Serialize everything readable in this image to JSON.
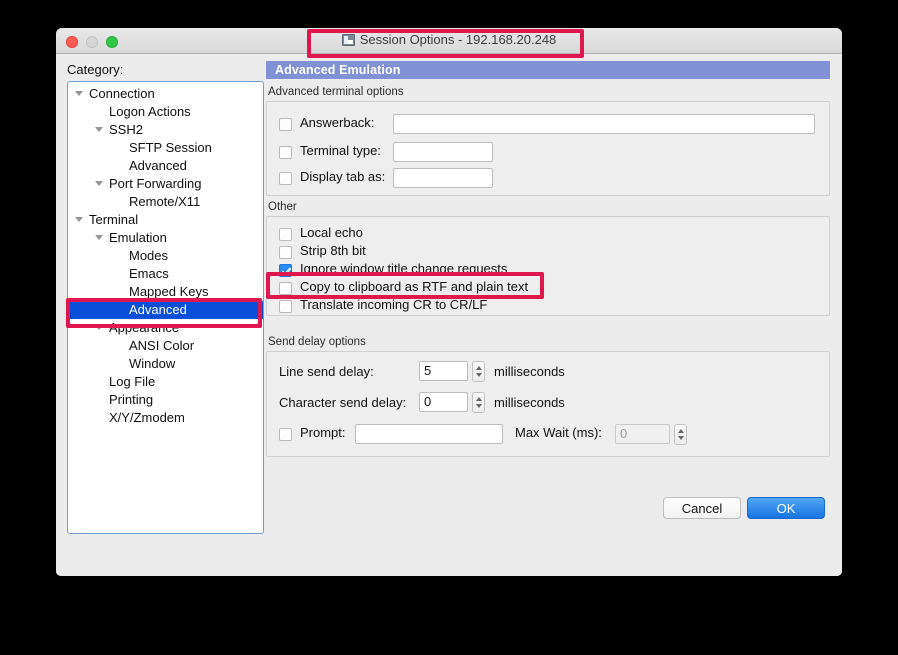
{
  "window": {
    "title": "Session Options - 192.168.20.248",
    "app_icon": "session-options-icon",
    "traffic_lights": [
      "close",
      "minimize",
      "zoom"
    ]
  },
  "sidebar": {
    "label": "Category:",
    "items": [
      {
        "label": "Connection",
        "indent": 0,
        "expandable": true,
        "selected": false
      },
      {
        "label": "Logon Actions",
        "indent": 1,
        "expandable": false,
        "selected": false
      },
      {
        "label": "SSH2",
        "indent": 1,
        "expandable": true,
        "selected": false
      },
      {
        "label": "SFTP Session",
        "indent": 2,
        "expandable": false,
        "selected": false
      },
      {
        "label": "Advanced",
        "indent": 2,
        "expandable": false,
        "selected": false
      },
      {
        "label": "Port Forwarding",
        "indent": 1,
        "expandable": true,
        "selected": false
      },
      {
        "label": "Remote/X11",
        "indent": 2,
        "expandable": false,
        "selected": false
      },
      {
        "label": "Terminal",
        "indent": 0,
        "expandable": true,
        "selected": false
      },
      {
        "label": "Emulation",
        "indent": 1,
        "expandable": true,
        "selected": false
      },
      {
        "label": "Modes",
        "indent": 2,
        "expandable": false,
        "selected": false
      },
      {
        "label": "Emacs",
        "indent": 2,
        "expandable": false,
        "selected": false
      },
      {
        "label": "Mapped Keys",
        "indent": 2,
        "expandable": false,
        "selected": false
      },
      {
        "label": "Advanced",
        "indent": 2,
        "expandable": false,
        "selected": true
      },
      {
        "label": "Appearance",
        "indent": 1,
        "expandable": true,
        "selected": false
      },
      {
        "label": "ANSI Color",
        "indent": 2,
        "expandable": false,
        "selected": false
      },
      {
        "label": "Window",
        "indent": 2,
        "expandable": false,
        "selected": false
      },
      {
        "label": "Log File",
        "indent": 1,
        "expandable": false,
        "selected": false
      },
      {
        "label": "Printing",
        "indent": 1,
        "expandable": false,
        "selected": false
      },
      {
        "label": "X/Y/Zmodem",
        "indent": 1,
        "expandable": false,
        "selected": false
      }
    ]
  },
  "panel": {
    "header": "Advanced Emulation",
    "groups": {
      "terminal_options": {
        "title": "Advanced terminal options",
        "rows": [
          {
            "label": "Answerback:",
            "checked": false,
            "value": "",
            "placeholder": ""
          },
          {
            "label": "Terminal type:",
            "checked": false,
            "value": "",
            "placeholder": ""
          },
          {
            "label": "Display tab as:",
            "checked": false,
            "value": "",
            "placeholder": ""
          }
        ]
      },
      "other": {
        "title": "Other",
        "checkboxes": [
          {
            "label": "Local echo",
            "checked": false
          },
          {
            "label": "Strip 8th bit",
            "checked": false
          },
          {
            "label": "Ignore window title change requests",
            "checked": true
          },
          {
            "label": "Copy to clipboard as RTF and plain text",
            "checked": false
          },
          {
            "label": "Translate incoming CR to CR/LF",
            "checked": false
          }
        ]
      },
      "send_delay": {
        "title": "Send delay options",
        "line_send_delay": {
          "label": "Line send delay:",
          "value": "5",
          "unit": "milliseconds"
        },
        "character_send_delay": {
          "label": "Character send delay:",
          "value": "0",
          "unit": "milliseconds"
        },
        "prompt": {
          "label": "Prompt:",
          "checked": false,
          "value": ""
        },
        "max_wait": {
          "label": "Max Wait (ms):",
          "value": "0",
          "disabled": true
        }
      }
    }
  },
  "footer": {
    "cancel_label": "Cancel",
    "ok_label": "OK"
  },
  "annotations": {
    "color": "#e0174f",
    "boxes": [
      "title-highlight",
      "sidebar-advanced-highlight",
      "ignore-title-checkbox-highlight"
    ]
  }
}
